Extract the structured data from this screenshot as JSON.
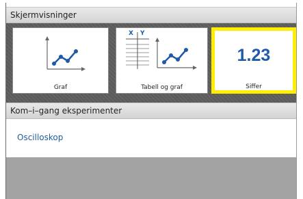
{
  "header": {
    "title": "Skjermvisninger"
  },
  "tiles": [
    {
      "label": "Graf",
      "icon": "line-graph-icon"
    },
    {
      "label": "Tabell og graf",
      "icon": "table-graph-icon",
      "table_header_x": "X",
      "table_header_y": "Y"
    },
    {
      "label": "Siffer",
      "icon": "digits-icon",
      "value": "1.23",
      "selected": true
    }
  ],
  "experiments": {
    "title": "Kom–i–gang eksperimenter",
    "items": [
      {
        "label": "Oscilloskop"
      }
    ]
  },
  "colors": {
    "selection_highlight": "#ffee00",
    "accent_blue": "#1e5aa8",
    "link_blue": "#1f5c99"
  }
}
